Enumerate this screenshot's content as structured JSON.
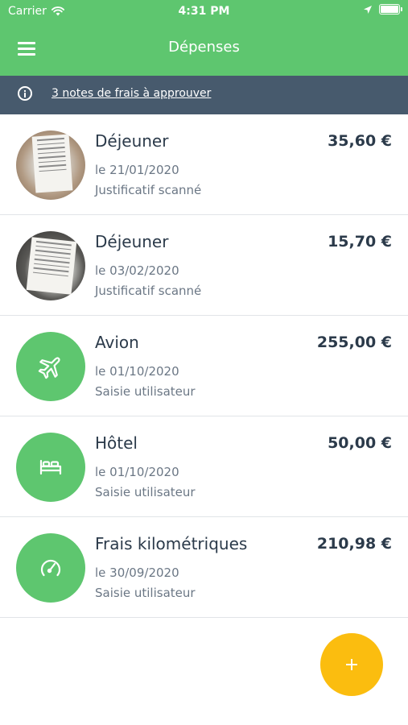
{
  "status_bar": {
    "carrier": "Carrier",
    "time": "4:31 PM",
    "icons": [
      "wifi-icon",
      "location-arrow-icon",
      "battery-icon"
    ]
  },
  "header": {
    "title": "Dépenses",
    "menu_icon": "hamburger-menu-icon"
  },
  "banner": {
    "icon": "info-icon",
    "link_text": "3 notes de frais à approuver"
  },
  "expenses": [
    {
      "title": "Déjeuner",
      "amount": "35,60 €",
      "date": "le 21/01/2020",
      "source": "Justificatif scanné",
      "thumbnail": "receipt-photo"
    },
    {
      "title": "Déjeuner",
      "amount": "15,70 €",
      "date": "le 03/02/2020",
      "source": "Justificatif scanné",
      "thumbnail": "receipt-photo"
    },
    {
      "title": "Avion",
      "amount": "255,00 €",
      "date": "le 01/10/2020",
      "source": "Saisie utilisateur",
      "icon": "airplane-icon"
    },
    {
      "title": "Hôtel",
      "amount": "50,00 €",
      "date": "le 01/10/2020",
      "source": "Saisie utilisateur",
      "icon": "bed-icon"
    },
    {
      "title": "Frais kilométriques",
      "amount": "210,98 €",
      "date": "le 30/09/2020",
      "source": "Saisie utilisateur",
      "icon": "speedometer-icon"
    }
  ],
  "fab": {
    "icon": "plus-icon"
  },
  "colors": {
    "header_green": "#5ec66f",
    "banner_slate": "#475a6d",
    "fab_yellow": "#fbbd0f",
    "text_dark": "#2b3a4a",
    "text_muted": "#6b7785"
  }
}
